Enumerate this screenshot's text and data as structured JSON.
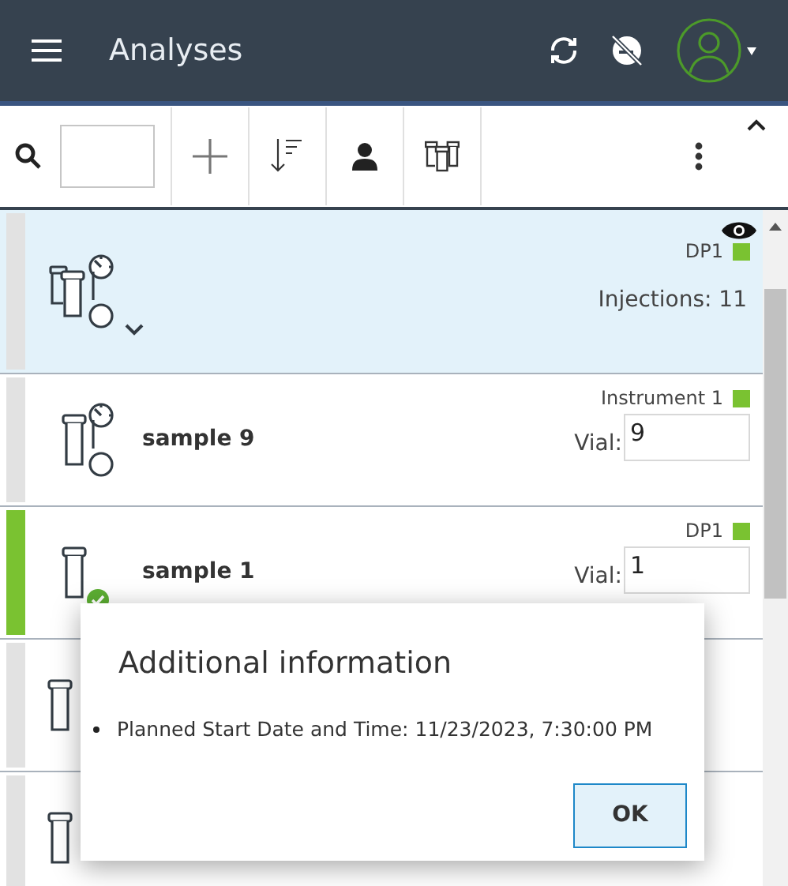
{
  "header": {
    "title": "Analyses"
  },
  "rows": [
    {
      "kind": "group",
      "scheduled": true,
      "completed": false,
      "selected": true,
      "instrument": "DP1",
      "color": "#7ac231",
      "injections": "Injections: 11"
    },
    {
      "kind": "sample",
      "scheduled": true,
      "completed": false,
      "selected": false,
      "name": "sample 9",
      "instrument": "Instrument 1",
      "color": "#7ac231",
      "vial_label": "Vial:",
      "vial": "9"
    },
    {
      "kind": "sample",
      "scheduled": false,
      "completed": true,
      "selected": false,
      "name": "sample 1",
      "instrument": "DP1",
      "color": "#7ac231",
      "vial_label": "Vial:",
      "vial": "1"
    },
    {
      "kind": "sample",
      "selected": false
    },
    {
      "kind": "sample",
      "selected": false
    }
  ],
  "dialog": {
    "title": "Additional information",
    "items": [
      "Planned Start Date and Time: 11/23/2023, 7:30:00 PM"
    ],
    "button": "OK"
  }
}
